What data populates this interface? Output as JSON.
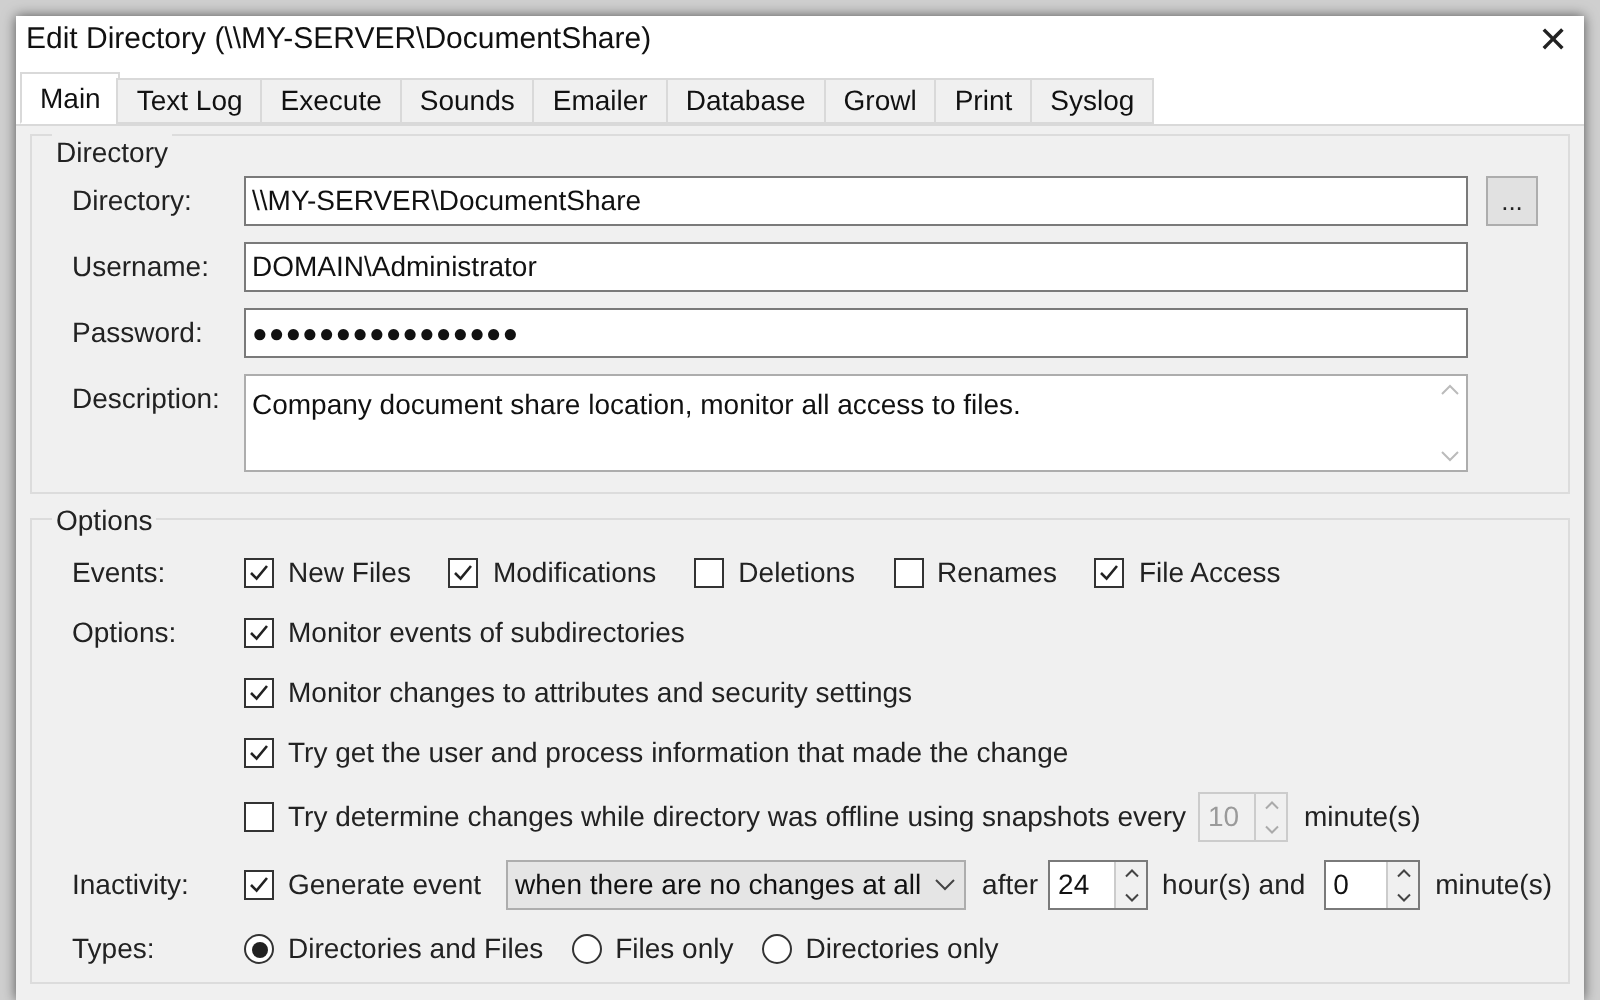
{
  "window": {
    "title": "Edit Directory (\\\\MY-SERVER\\DocumentShare)",
    "close": "✕"
  },
  "tabs": [
    {
      "label": "Main",
      "selected": true
    },
    {
      "label": "Text Log",
      "selected": false
    },
    {
      "label": "Execute",
      "selected": false
    },
    {
      "label": "Sounds",
      "selected": false
    },
    {
      "label": "Emailer",
      "selected": false
    },
    {
      "label": "Database",
      "selected": false
    },
    {
      "label": "Growl",
      "selected": false
    },
    {
      "label": "Print",
      "selected": false
    },
    {
      "label": "Syslog",
      "selected": false
    }
  ],
  "directory": {
    "legend": "Directory",
    "browse_button": "...",
    "fields": [
      {
        "kind": "text",
        "label": "Directory:",
        "value": "\\\\MY-SERVER\\DocumentShare"
      },
      {
        "kind": "text",
        "label": "Username:",
        "value": "DOMAIN\\Administrator"
      },
      {
        "kind": "password",
        "label": "Password:",
        "value": "●●●●●●●●●●●●●●●●"
      },
      {
        "kind": "multiline",
        "label": "Description:",
        "value": "Company document share location, monitor all access to files."
      }
    ]
  },
  "options": {
    "legend": "Options",
    "events": {
      "label": "Events:",
      "items": [
        {
          "label": "New Files",
          "checked": true
        },
        {
          "label": "Modifications",
          "checked": true
        },
        {
          "label": "Deletions",
          "checked": false
        },
        {
          "label": "Renames",
          "checked": false
        },
        {
          "label": "File Access",
          "checked": true
        }
      ]
    },
    "monitor": {
      "label": "Options:",
      "items": [
        {
          "kind": "plain",
          "label": "Monitor events of subdirectories",
          "checked": true
        },
        {
          "kind": "plain",
          "label": "Monitor changes to attributes and security settings",
          "checked": true
        },
        {
          "kind": "plain",
          "label": "Try get the user and process information that made the change",
          "checked": true
        },
        {
          "kind": "snapshot",
          "label": "Try determine changes while directory was offline using snapshots every",
          "checked": false,
          "spinner": {
            "value": "10",
            "disabled": true
          },
          "unit": "minute(s)"
        }
      ]
    },
    "inactivity": {
      "label": "Inactivity:",
      "checkbox": {
        "label": "Generate event",
        "checked": true
      },
      "dropdown": "when there are no changes at all",
      "after": "after",
      "hours": {
        "value": "24",
        "disabled": false
      },
      "hours_label": "hour(s) and",
      "minutes": {
        "value": "0",
        "disabled": false
      },
      "minutes_label": "minute(s)"
    },
    "types": {
      "label": "Types:",
      "items": [
        {
          "label": "Directories and Files",
          "selected": true
        },
        {
          "label": "Files only",
          "selected": false
        },
        {
          "label": "Directories only",
          "selected": false
        }
      ]
    }
  }
}
